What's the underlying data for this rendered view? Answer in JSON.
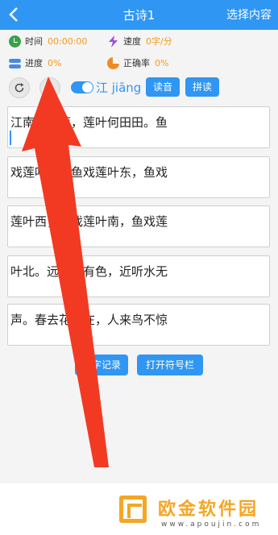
{
  "header": {
    "title": "古诗1",
    "right_action": "选择内容"
  },
  "stats": {
    "time": {
      "label": "时间",
      "value": "00:00:00"
    },
    "speed": {
      "label": "速度",
      "value": "0字/分"
    },
    "progress": {
      "label": "进度",
      "value": "0%"
    },
    "accuracy": {
      "label": "正确率",
      "value": "0%"
    }
  },
  "controls": {
    "pinyin": "江 jiāng",
    "read_label": "读音",
    "spell_label": "拼读"
  },
  "lines": [
    "江南可采莲，莲叶何田田。鱼",
    "戏莲叶间。鱼戏莲叶东，鱼戏",
    "莲叶西，鱼戏莲叶南，鱼戏莲",
    "叶北。远看山有色，近听水无",
    "声。春去花还在，人来鸟不惊"
  ],
  "bottom_buttons": {
    "records": "练字记录",
    "symbols": "打开符号栏"
  },
  "watermark": {
    "name": "欧金软件园",
    "url": "www.apoujin.com"
  }
}
